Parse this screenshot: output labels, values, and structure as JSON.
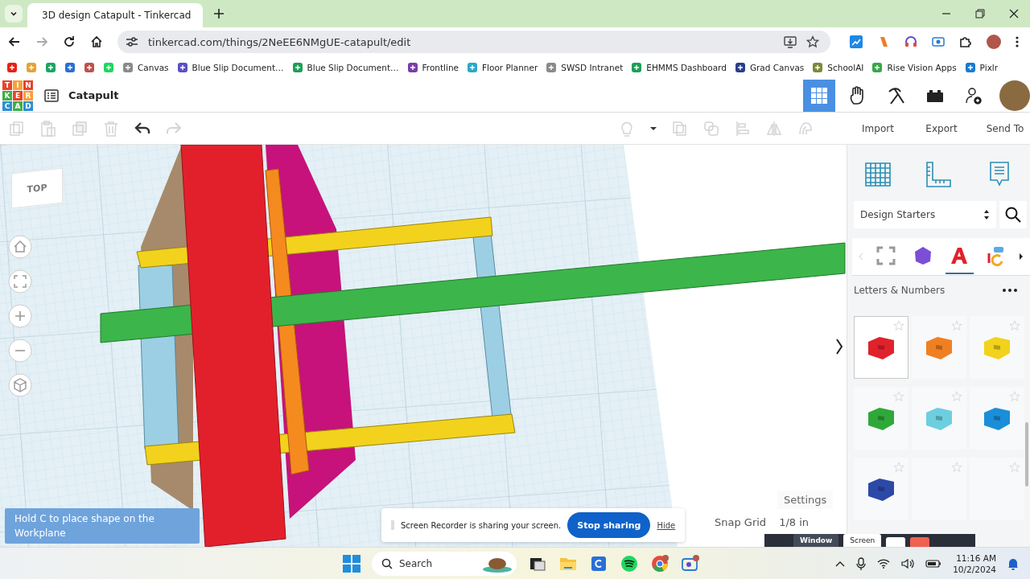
{
  "browser": {
    "tabs": [
      {
        "title": "3D design Catapult - Tinkercad",
        "selected": true
      }
    ],
    "nav_buttons": [
      {
        "kind": "back",
        "disabled": false
      },
      {
        "kind": "forward",
        "disabled": true
      },
      {
        "kind": "reload",
        "disabled": false
      },
      {
        "kind": "home",
        "disabled": false
      }
    ],
    "url": "tinkercad.com/things/2NeEE6NMgUE-catapult/edit",
    "bookmarks": [
      {
        "color": "#e62117"
      },
      {
        "color": "#e4a23a"
      },
      {
        "color": "#1fa463"
      },
      {
        "color": "#2a6fd6"
      },
      {
        "color": "#c0504d"
      },
      {
        "color": "#1ed760"
      },
      {
        "label": "Canvas",
        "color": "#8a8a8a"
      },
      {
        "label": "Blue Slip Document…",
        "color": "#5b4fc4"
      },
      {
        "label": "Blue Slip Document…",
        "color": "#1e9e57"
      },
      {
        "label": "Frontline",
        "color": "#7a3ea8"
      },
      {
        "label": "Floor Planner",
        "color": "#2aa8c9"
      },
      {
        "label": "SWSD Intranet",
        "color": "#8a8a8a"
      },
      {
        "label": "EHMMS Dashboard",
        "color": "#1e9e57"
      },
      {
        "label": "Grad Canvas",
        "color": "#2b3f8c"
      },
      {
        "label": "SchoolAI",
        "color": "#7a8a3a"
      },
      {
        "label": "Rise Vision Apps",
        "color": "#3aa64a"
      },
      {
        "label": "Pixlr",
        "color": "#1a7bd1"
      }
    ]
  },
  "app": {
    "logo_letters": [
      "T",
      "I",
      "N",
      "K",
      "E",
      "R",
      "C",
      "A",
      "D"
    ],
    "title": "Catapult",
    "view_buttons": [
      {
        "kind": "grid",
        "selected": true
      },
      {
        "kind": "hand",
        "selected": false
      },
      {
        "kind": "pickaxe",
        "selected": false
      },
      {
        "kind": "brick",
        "selected": false
      },
      {
        "kind": "invite",
        "selected": false
      }
    ]
  },
  "toolbar": {
    "tools": [
      {
        "kind": "copy",
        "disabled": true
      },
      {
        "kind": "paste",
        "disabled": true
      },
      {
        "kind": "duplicate",
        "disabled": true
      },
      {
        "kind": "delete",
        "disabled": true
      },
      {
        "kind": "undo",
        "disabled": false
      },
      {
        "kind": "redo",
        "disabled": true
      },
      {
        "kind": "bulb",
        "disabled": true
      },
      {
        "kind": "caret",
        "disabled": false
      },
      {
        "kind": "group",
        "disabled": true
      },
      {
        "kind": "ungroup",
        "disabled": true
      },
      {
        "kind": "align",
        "disabled": true
      },
      {
        "kind": "mirror",
        "disabled": true
      },
      {
        "kind": "cruise",
        "disabled": true
      }
    ],
    "actions": [
      "Import",
      "Export",
      "Send To"
    ]
  },
  "canvas": {
    "view_cube": "TOP",
    "hint": "Hold C to place shape on the Workplane",
    "settings": "Settings",
    "snap_grid_label": "Snap Grid",
    "snap_grid_value": "1/8 in"
  },
  "screen_recorder": {
    "message": "Screen Recorder is sharing your screen.",
    "stop": "Stop sharing",
    "hide": "Hide",
    "controls": [
      "Window",
      "Screen"
    ]
  },
  "panel": {
    "tools": [
      {
        "kind": "workplane"
      },
      {
        "kind": "ruler"
      },
      {
        "kind": "notes"
      }
    ],
    "library": "Design Starters",
    "categories": [
      {
        "kind": "frame",
        "selected": false
      },
      {
        "kind": "hexagon",
        "selected": false
      },
      {
        "kind": "letter",
        "selected": true
      },
      {
        "kind": "mixed",
        "selected": false
      }
    ],
    "section": "Letters & Numbers",
    "shapes": [
      {
        "color": "#e0222c",
        "selected": true
      },
      {
        "color": "#f07f22",
        "selected": false
      },
      {
        "color": "#f2d21c",
        "selected": false
      },
      {
        "color": "#2fa83a",
        "selected": false
      },
      {
        "color": "#6ccfe0",
        "selected": false
      },
      {
        "color": "#1a8ed8",
        "selected": false
      },
      {
        "color": "#2c49a8",
        "selected": false
      },
      {
        "selected": false
      },
      {
        "selected": false
      }
    ]
  },
  "taskbar": {
    "search": "Search",
    "apps": [
      {
        "kind": "dark-app"
      },
      {
        "kind": "folder"
      },
      {
        "kind": "c-app"
      },
      {
        "kind": "spotify"
      },
      {
        "kind": "chrome"
      },
      {
        "kind": "camera"
      }
    ],
    "time": "11:16 AM",
    "date": "10/2/2024"
  }
}
